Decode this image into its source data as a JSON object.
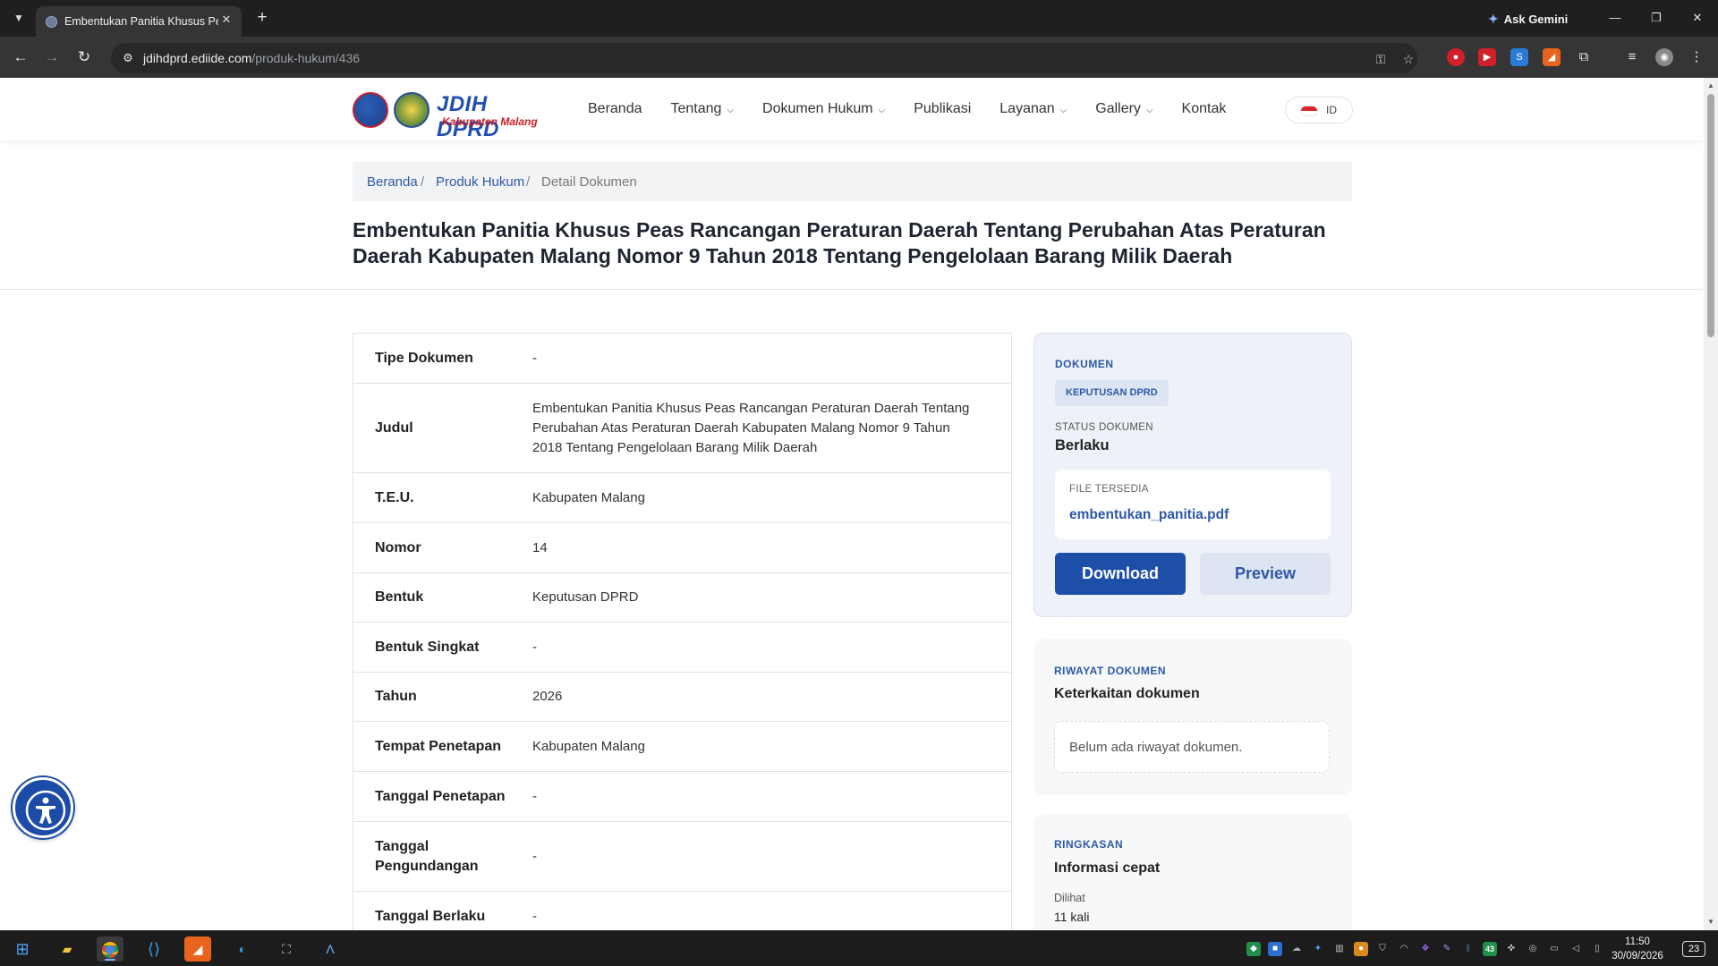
{
  "browser": {
    "tab_title": "Embentukan Panitia Khusus Peas",
    "ask_gemini": "Ask Gemini",
    "url_host": "jdihdprd.ediide.com",
    "url_path": "/produk-hukum/436"
  },
  "site": {
    "brand": "JDIH DPRD",
    "brand_sub": "Kabupaten Malang",
    "nav": [
      {
        "label": "Beranda",
        "has_dropdown": false
      },
      {
        "label": "Tentang",
        "has_dropdown": true
      },
      {
        "label": "Dokumen Hukum",
        "has_dropdown": true
      },
      {
        "label": "Publikasi",
        "has_dropdown": false
      },
      {
        "label": "Layanan",
        "has_dropdown": true
      },
      {
        "label": "Gallery",
        "has_dropdown": true
      },
      {
        "label": "Kontak",
        "has_dropdown": false
      }
    ],
    "language": "ID"
  },
  "breadcrumb": {
    "home": "Beranda",
    "section": "Produk Hukum",
    "current": "Detail Dokumen",
    "separator": "/"
  },
  "page_title": "Embentukan Panitia Khusus Peas Rancangan Peraturan Daerah Tentang Perubahan Atas Peraturan Daerah Kabupaten Malang Nomor 9 Tahun 2018 Tentang Pengelolaan Barang Milik Daerah",
  "details": [
    {
      "label": "Tipe Dokumen",
      "value": "-"
    },
    {
      "label": "Judul",
      "value": "Embentukan Panitia Khusus Peas Rancangan Peraturan Daerah Tentang Perubahan Atas Peraturan Daerah Kabupaten Malang Nomor 9 Tahun 2018 Tentang Pengelolaan Barang Milik Daerah"
    },
    {
      "label": "T.E.U.",
      "value": "Kabupaten Malang"
    },
    {
      "label": "Nomor",
      "value": "14"
    },
    {
      "label": "Bentuk",
      "value": "Keputusan DPRD"
    },
    {
      "label": "Bentuk Singkat",
      "value": "-"
    },
    {
      "label": "Tahun",
      "value": "2026"
    },
    {
      "label": "Tempat Penetapan",
      "value": "Kabupaten Malang"
    },
    {
      "label": "Tanggal Penetapan",
      "value": "-"
    },
    {
      "label": "Tanggal Pengundangan",
      "value": "-"
    },
    {
      "label": "Tanggal Berlaku",
      "value": "-"
    }
  ],
  "document_card": {
    "kicker": "DOKUMEN",
    "category_chip": "KEPUTUSAN DPRD",
    "status_label": "STATUS DOKUMEN",
    "status_value": "Berlaku",
    "file_label": "FILE TERSEDIA",
    "file_name": "embentukan_panitia.pdf",
    "download_label": "Download",
    "preview_label": "Preview"
  },
  "history_card": {
    "kicker": "RIWAYAT DOKUMEN",
    "title": "Keterkaitan dokumen",
    "empty_text": "Belum ada riwayat dokumen."
  },
  "summary_card": {
    "kicker": "RINGKASAN",
    "title": "Informasi cepat",
    "views_label": "Dilihat",
    "views_value": "11 kali"
  },
  "taskbar": {
    "time": "11:50",
    "date": "30/09/2026",
    "notification_count": "23",
    "tray_badge": "43"
  },
  "colors": {
    "brand_blue": "#1e4fa8",
    "accent_red": "#c81c25",
    "card_bg": "#eef2f8"
  }
}
